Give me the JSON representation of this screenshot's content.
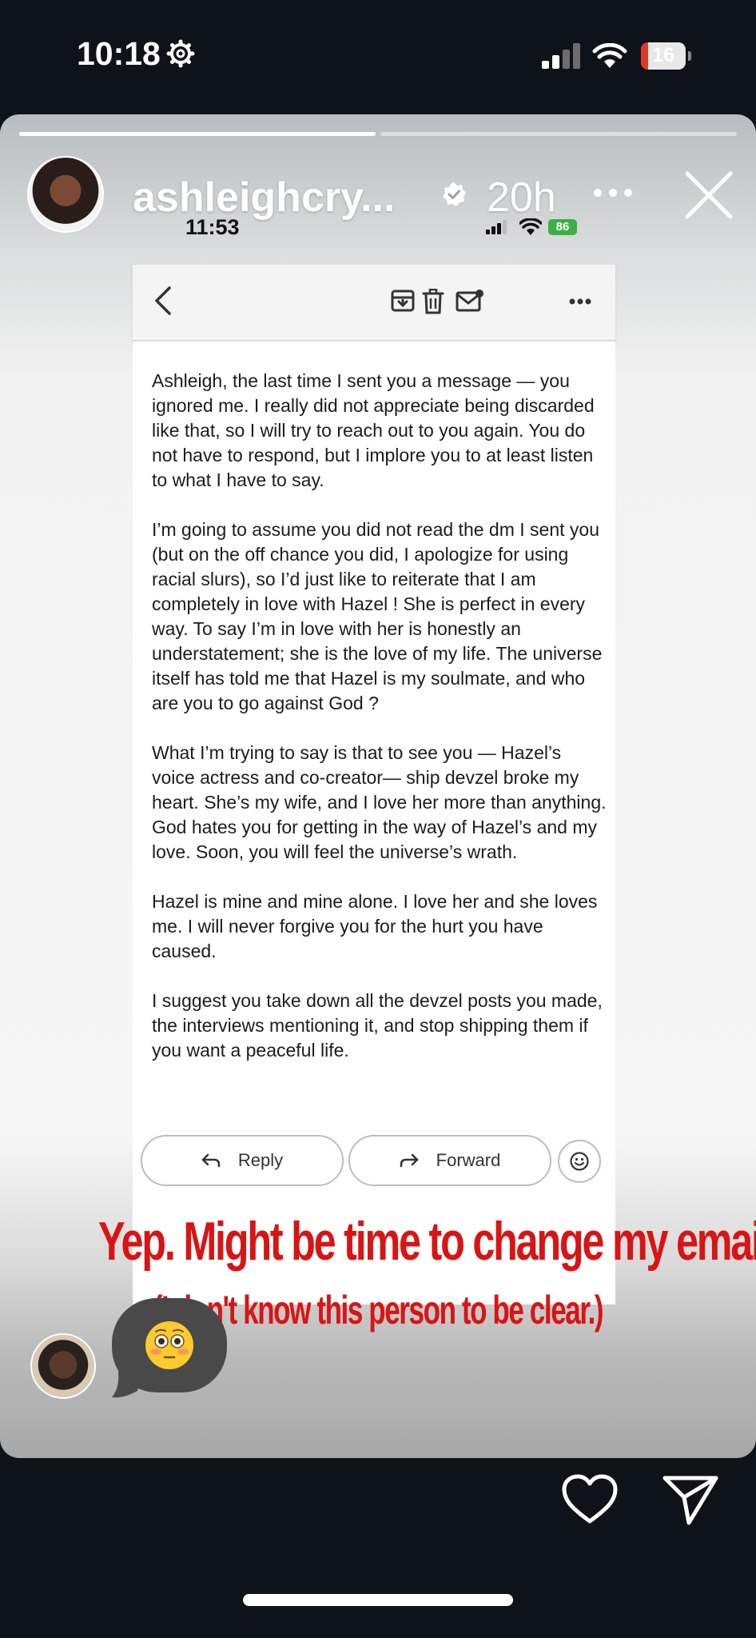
{
  "status_bar": {
    "time": "10:18",
    "battery_level": "16",
    "icons": [
      "gear-icon",
      "signal-icon",
      "wifi-icon",
      "battery-icon"
    ]
  },
  "story": {
    "progress_segments": [
      1.0,
      0.0
    ],
    "username": "ashleighcry...",
    "time_ago": "20h",
    "verified": true,
    "caption_main": "Yep. Might be time to change my email.",
    "caption_sub": "(I don't know this person to be clear.)",
    "reaction": "flushed-face-emoji",
    "colors": {
      "caption": "#d91414",
      "reaction_bubble": "#494949",
      "inner_battery": "#3cb043"
    }
  },
  "inner_screenshot": {
    "time": "11:53",
    "battery": "86",
    "email_paragraphs": [
      "Ashleigh, the last time I sent you a message — you ignored me. I really did not appreciate being discarded like that, so I will try to reach out to you again. You do not have to respond, but I implore you to at least listen to what I have to say.",
      "I’m going to assume you did not read the dm I sent you (but on the off chance you did, I apologize for using racial slurs), so I’d just like to reiterate that I am completely in love with Hazel ! She is perfect in every way. To say I’m in love with her is honestly an understatement; she is the love of my life. The universe itself has told me that Hazel is my soulmate, and who are you to go against God ?",
      "What I’m trying to say is that to see you — Hazel’s voice actress and co-creator— ship devzel broke my heart. She’s my wife, and I love her more than anything. God hates you for getting in the way of Hazel’s and my love. Soon, you will feel the universe’s wrath.",
      "Hazel is mine and mine alone. I love her and she loves me. I will never forgive you for the hurt you have caused.",
      "I suggest you take down all the devzel posts you made, the interviews mentioning it, and stop shipping them if you want a peaceful life."
    ],
    "reply_label": "Reply",
    "forward_label": "Forward"
  }
}
